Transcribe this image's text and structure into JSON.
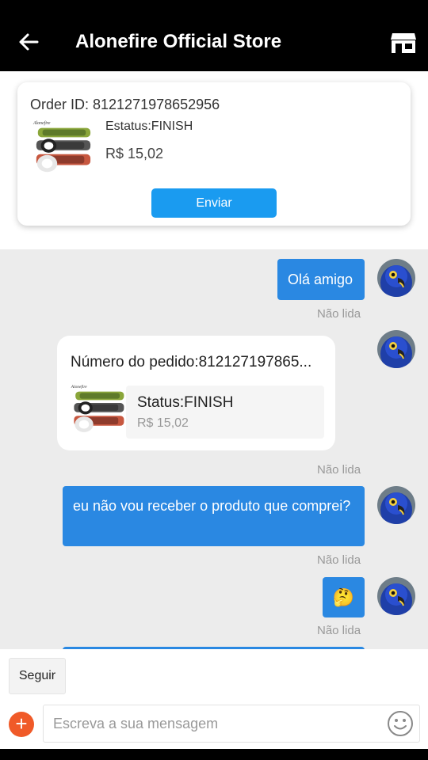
{
  "header": {
    "title": "Alonefire Official Store",
    "back_icon": "arrow-left-icon",
    "store_icon": "store-icon"
  },
  "order": {
    "order_id": "Order ID: 8121271978652956",
    "status": "Estatus:FINISH",
    "price": "R$ 15,02",
    "send_label": "Enviar"
  },
  "messages": [
    {
      "type": "text",
      "text": "Olá amigo",
      "read": "Não lida"
    },
    {
      "type": "product",
      "title": "Número do pedido:812127197865...",
      "status": "Status:FINISH",
      "price": "R$ 15,02",
      "read": "Não lida"
    },
    {
      "type": "text",
      "text": "eu não vou receber o produto que comprei?",
      "read": "Não lida"
    },
    {
      "type": "emoji",
      "emoji": "🤔",
      "read": "Não lida"
    }
  ],
  "bottom": {
    "follow_label": "Seguir",
    "placeholder": "Escreva a sua mensagem",
    "add_icon": "plus-icon",
    "emoji_icon": "smiley-icon"
  },
  "colors": {
    "accent_blue": "#2a88e2",
    "button_blue": "#1a9bf0",
    "add_orange": "#f05a28"
  }
}
